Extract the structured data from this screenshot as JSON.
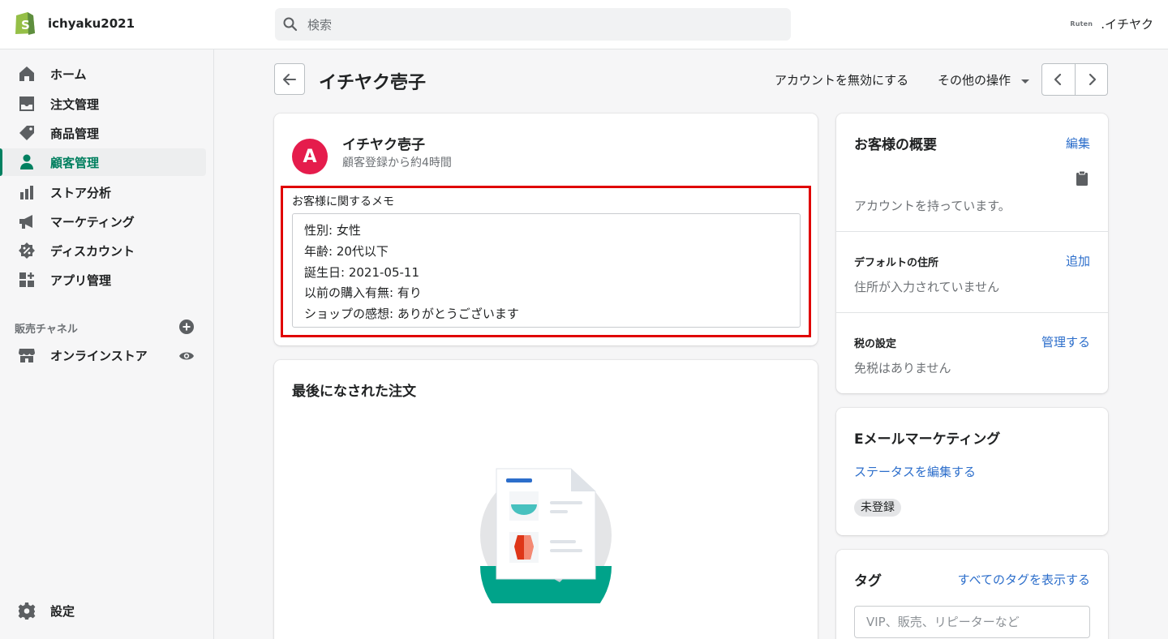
{
  "topbar": {
    "store_name": "ichyaku2021",
    "search_placeholder": "検索",
    "account_logo_text": "Ruten",
    "account_name": ".イチヤク"
  },
  "sidebar": {
    "items": [
      {
        "label": "ホーム",
        "icon": "home-icon"
      },
      {
        "label": "注文管理",
        "icon": "orders-icon"
      },
      {
        "label": "商品管理",
        "icon": "tag-icon"
      },
      {
        "label": "顧客管理",
        "icon": "customer-icon",
        "active": true
      },
      {
        "label": "ストア分析",
        "icon": "analytics-icon"
      },
      {
        "label": "マーケティング",
        "icon": "megaphone-icon"
      },
      {
        "label": "ディスカウント",
        "icon": "discount-icon"
      },
      {
        "label": "アプリ管理",
        "icon": "apps-icon"
      }
    ],
    "sales_channels_title": "販売チャネル",
    "online_store": "オンラインストア",
    "settings": "設定"
  },
  "header": {
    "title": "イチヤク壱子",
    "disable_account": "アカウントを無効にする",
    "more_actions": "その他の操作"
  },
  "customer_card": {
    "avatar_letter": "A",
    "name": "イチヤク壱子",
    "subtitle": "顧客登録から約4時間",
    "memo_label": "お客様に関するメモ",
    "memo_lines": [
      "性別: 女性",
      "年齢: 20代以下",
      "誕生日: 2021-05-11",
      "以前の購入有無: 有り",
      "ショップの感想: ありがとうございます"
    ]
  },
  "last_order": {
    "title": "最後になされた注文"
  },
  "overview": {
    "title": "お客様の概要",
    "edit": "編集",
    "account_status": "アカウントを持っています。",
    "default_address_title": "デフォルトの住所",
    "add": "追加",
    "no_address": "住所が入力されていません",
    "tax_title": "税の設定",
    "manage": "管理する",
    "no_tax_exemption": "免税はありません"
  },
  "email_marketing": {
    "title": "Eメールマーケティング",
    "edit_status": "ステータスを編集する",
    "badge": "未登録"
  },
  "tags": {
    "title": "タグ",
    "view_all": "すべてのタグを表示する",
    "placeholder": "VIP、販売、リピーターなど"
  },
  "colors": {
    "accent": "#008060",
    "link": "#2c6ecb",
    "avatar": "#e51c4c",
    "highlight": "#e00000"
  }
}
